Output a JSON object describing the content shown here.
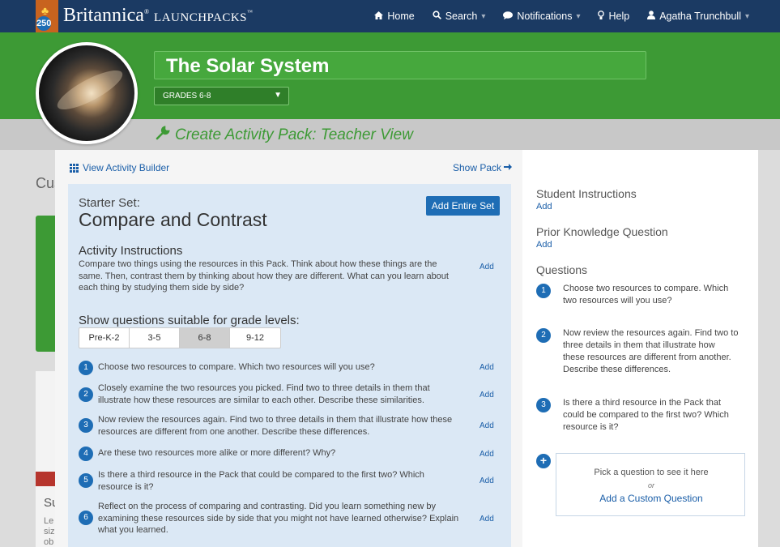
{
  "topbar": {
    "logo_num": "250",
    "brand": "Britannica",
    "brand_sub": "LaunchPacks",
    "nav": [
      {
        "label": "Home",
        "icon": "home-icon"
      },
      {
        "label": "Search",
        "icon": "search-icon"
      },
      {
        "label": "Notifications",
        "icon": "chat-icon"
      },
      {
        "label": "Help",
        "icon": "lightbulb-icon"
      },
      {
        "label": "Agatha Trunchbull",
        "icon": "user-icon"
      }
    ]
  },
  "header": {
    "title": "The Solar System",
    "grade": "GRADES 6-8",
    "subtitle": "Create Activity Pack: Teacher View"
  },
  "background": {
    "cus": "Cus",
    "su": "Su",
    "le": [
      "Le",
      "siz",
      "ob"
    ]
  },
  "modal": {
    "view_builder": "View Activity Builder",
    "show_pack": "Show Pack",
    "starter_label": "Starter Set:",
    "starter_title": "Compare and Contrast",
    "add_entire_set": "Add Entire Set",
    "instructions_head": "Activity Instructions",
    "instructions_body": "Compare two things using the resources in this Pack. Think about how these things are the same. Then, contrast them by thinking about how they are different. What can you learn about each thing by studying them side by side?",
    "add": "Add",
    "grade_head": "Show questions suitable for grade levels:",
    "grade_tabs": [
      "Pre-K-2",
      "3-5",
      "6-8",
      "9-12"
    ],
    "questions": [
      "Choose two resources to compare. Which two resources will you use?",
      "Closely examine the two resources you picked. Find two to three details in them that illustrate how these resources are similar to each other. Describe these similarities.",
      "Now review the resources again. Find two to three details in them that illustrate how these resources are different from one another. Describe these differences.",
      "Are these two resources more alike or more different? Why?",
      "Is there a third resource in the Pack that could be compared to the first two? Which resource is it?",
      "Reflect on the process of comparing and contrasting. Did you learn something new by examining these resources side by side that you might not have learned otherwise? Explain what you learned."
    ]
  },
  "right": {
    "student_instructions": "Student Instructions",
    "prior_knowledge": "Prior Knowledge Question",
    "add": "Add",
    "questions_head": "Questions",
    "questions": [
      "Choose two resources to compare. Which two resources will you use?",
      "Now review the resources again. Find two to three details in them that illustrate how these resources are different from another. Describe these differences.",
      "Is there a third resource in the Pack that could be compared to the first two? Which resource is it?"
    ],
    "pick_text": "Pick a question to see it here",
    "pick_or": "or",
    "add_custom": "Add a Custom Question"
  }
}
